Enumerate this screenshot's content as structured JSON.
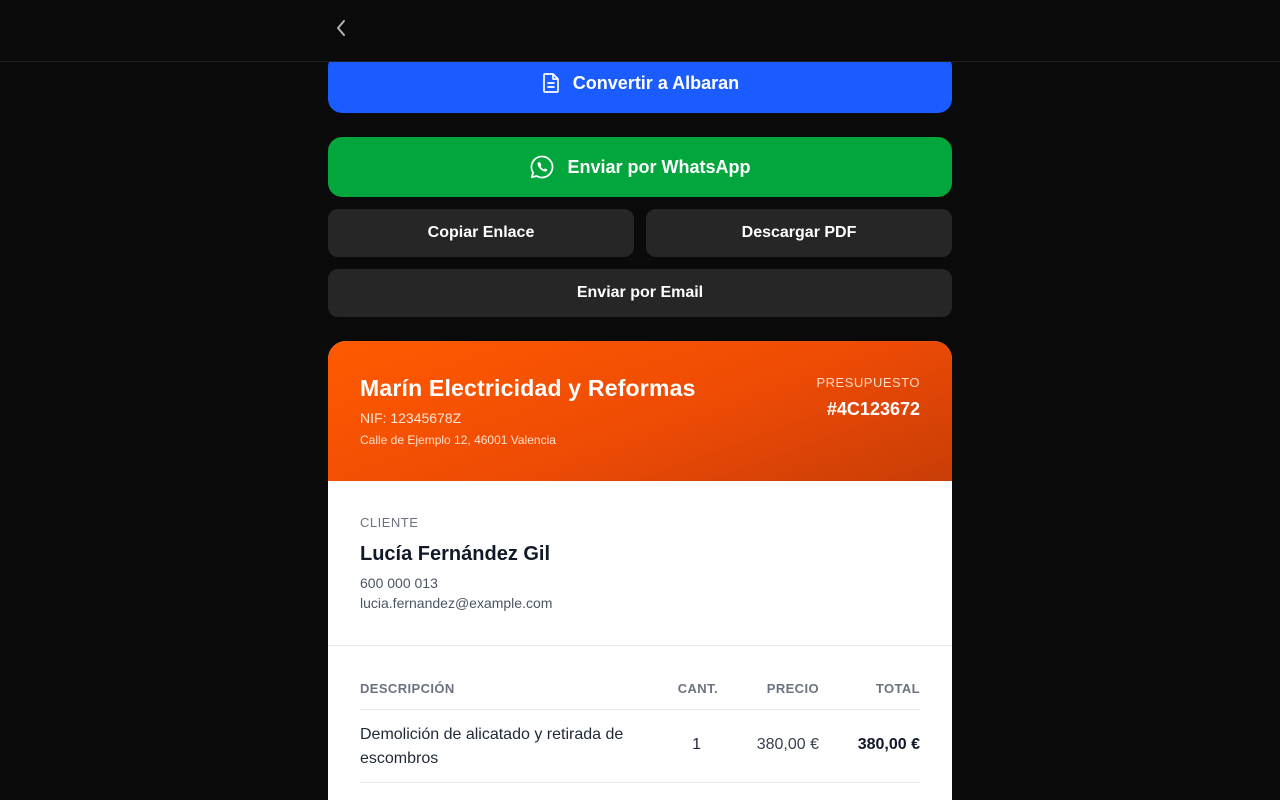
{
  "actions": {
    "albaran_label": "Convertir a Albaran",
    "whatsapp_label": "Enviar por WhatsApp",
    "copy_link_label": "Copiar Enlace",
    "download_pdf_label": "Descargar PDF",
    "email_label": "Enviar por Email"
  },
  "icons": {
    "back": "chevron-left-icon",
    "albaran": "document-icon",
    "whatsapp": "whatsapp-icon"
  },
  "colors": {
    "primary_blue": "#1a5cff",
    "whatsapp_green": "#03a63c",
    "header_orange": "#ff5a00",
    "dark_button": "#262626"
  },
  "company": {
    "name": "Marín Electricidad y Reformas",
    "nif": "NIF: 12345678Z",
    "address": "Calle de Ejemplo 12, 46001 Valencia"
  },
  "quote": {
    "label": "PRESUPUESTO",
    "number": "#4C123672"
  },
  "client": {
    "label": "CLIENTE",
    "name": "Lucía Fernández Gil",
    "phone": "600 000 013",
    "email": "lucia.fernandez@example.com"
  },
  "table": {
    "headers": {
      "description": "DESCRIPCIÓN",
      "quantity": "CANT.",
      "price": "PRECIO",
      "total": "TOTAL"
    },
    "rows": [
      {
        "description": "Demolición de alicatado y retirada de escombros",
        "quantity": "1",
        "price": "380,00 €",
        "total": "380,00 €"
      }
    ]
  }
}
